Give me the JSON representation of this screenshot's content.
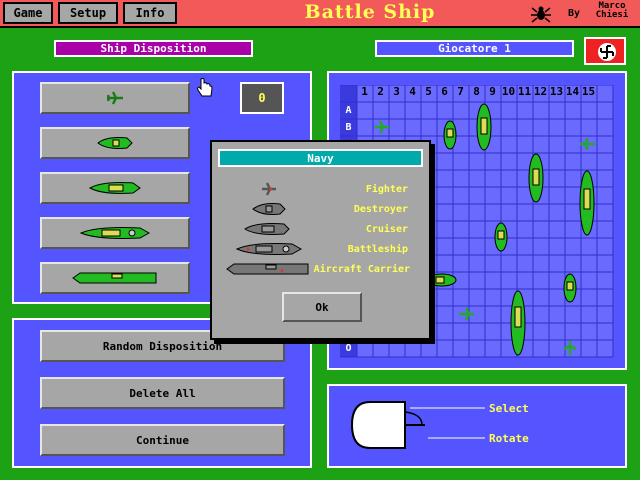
{
  "menu": {
    "game": "Game",
    "setup": "Setup",
    "info": "Info"
  },
  "app_title": "Battle Ship",
  "byline": {
    "by": "By",
    "author_line1": "Marco",
    "author_line2": "Chiesi"
  },
  "header": {
    "ship_disposition": "Ship Disposition",
    "player": "Giocatore 1"
  },
  "ship_count": "0",
  "actions": {
    "random": "Random Disposition",
    "delete": "Delete All",
    "continue": "Continue"
  },
  "grid": {
    "columns": [
      "1",
      "2",
      "3",
      "4",
      "5",
      "6",
      "7",
      "8",
      "9",
      "10",
      "11",
      "12",
      "13",
      "14",
      "15"
    ],
    "rows_visible": [
      "A",
      "B"
    ],
    "last_row": "O"
  },
  "mouse": {
    "left": "Select",
    "right": "Rotate"
  },
  "dialog": {
    "title": "Navy",
    "items": [
      "Fighter",
      "Destroyer",
      "Cruiser",
      "Battleship",
      "Aircraft Carrier"
    ],
    "ok": "Ok"
  },
  "colors": {
    "background": "#1ca214",
    "panel": "#5555ff",
    "title_bar": "#f25a5a",
    "ship_green": "#22bb22",
    "dialog_title": "#00aaaa"
  }
}
